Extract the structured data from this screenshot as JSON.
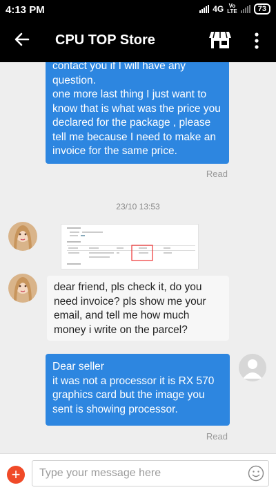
{
  "status": {
    "time": "4:13 PM",
    "network": "4G",
    "volte_top": "Vo",
    "volte_bottom": "LTE",
    "battery": "73"
  },
  "header": {
    "title": "CPU TOP Store",
    "back_icon": "arrow-left-icon",
    "store_icon": "store-icon",
    "menu_icon": "more-vertical-icon"
  },
  "messages": {
    "m1": {
      "text": "contact you if I will have any\nquestion.\none more last thing I just want to\nknow that is what was the price you\ndeclared for the package , please\ntell me because I need to make an\ninvoice for the same price.",
      "status": "Read"
    },
    "timestamp": "23/10 13:53",
    "m3": {
      "text": "dear friend, pls check it, do you\nneed invoice? pls show me your\nemail, and tell me how much\nmoney i write on the parcel?"
    },
    "m4": {
      "text": "Dear seller\n it was not a processor it is RX 570\ngraphics card but the image you\nsent is showing processor.",
      "status": "Read"
    }
  },
  "input": {
    "placeholder": "Type your message here",
    "add_icon": "plus-icon",
    "emoji_icon": "smiley-icon"
  },
  "colors": {
    "outgoing": "#2d86e0",
    "incoming": "#f7f7f7",
    "background": "#eeeeee",
    "add": "#f04a28"
  }
}
